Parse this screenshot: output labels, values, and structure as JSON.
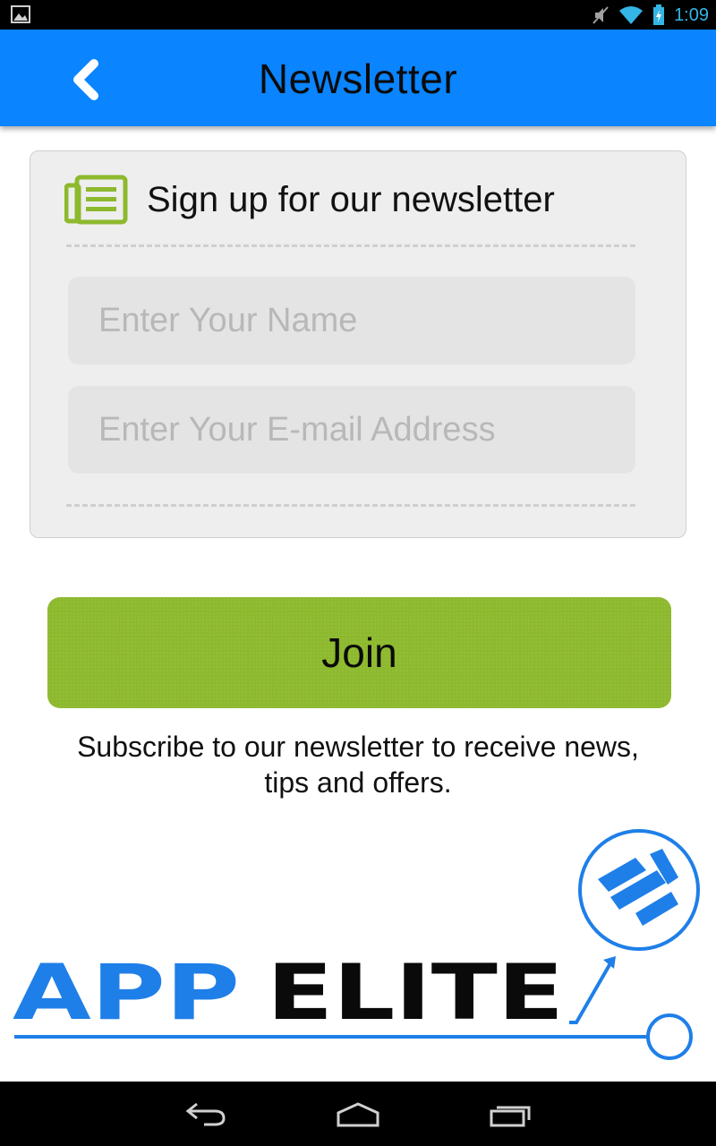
{
  "status_bar": {
    "time": "1:09"
  },
  "header": {
    "title": "Newsletter",
    "back_icon": "chevron-left-icon"
  },
  "card": {
    "icon": "newspaper-icon",
    "heading": "Sign up for our newsletter",
    "name_placeholder": "Enter Your Name",
    "email_placeholder": "Enter Your E-mail Address"
  },
  "join": {
    "label": "Join"
  },
  "subscribe": {
    "line1": "Subscribe to our newsletter to receive news,",
    "line2": "tips and offers."
  },
  "logo": {
    "word1": "APP",
    "word2": "ELITE"
  },
  "colors": {
    "header": "#0a84ff",
    "join": "#8db92e",
    "card_icon": "#8db92e",
    "logo_blue": "#1f7fe8",
    "status_icons": "#33b5e5"
  }
}
